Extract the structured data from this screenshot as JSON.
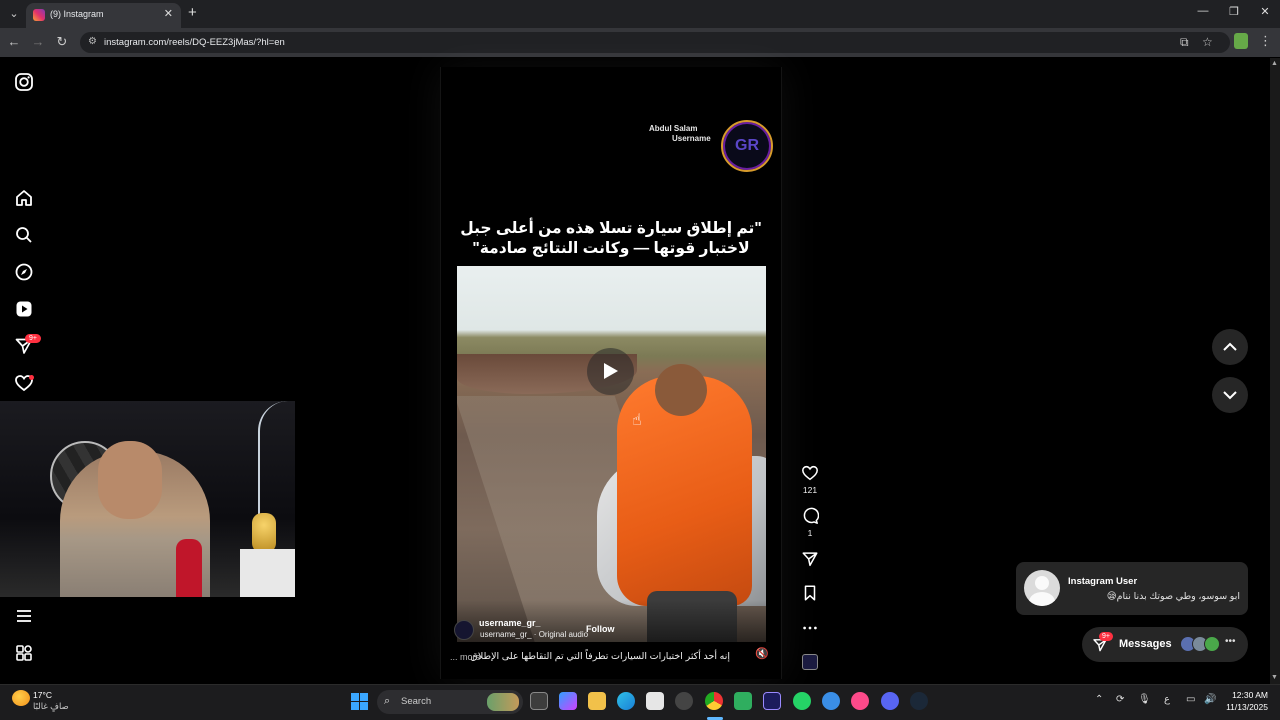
{
  "browser": {
    "tab_title": "(9) Instagram",
    "url": "instagram.com/reels/DQ-EEZ3jMas/?hl=en"
  },
  "sidebar": {
    "messages_badge": "9+"
  },
  "reel": {
    "creator_name": "Abdul Salam",
    "creator_user": "Username",
    "creator_logo_text": "GR",
    "caption": "\"تم إطلاق سيارة تسلا هذه من أعلى جبل لاختبار قوتها — وكانت النتائج صادمة\"",
    "username": "username_gr_",
    "audio": "username_gr_ · Original audio",
    "follow_label": "Follow",
    "description": "إنه أحد أكثر اختبارات السيارات تطرفاً التي تم التقاطها على الإطلاق",
    "more_label": "... more",
    "likes": "121",
    "comments": "1"
  },
  "toast": {
    "title": "Instagram User",
    "message": "ابو سوسو، وطي صوتك بدنا ننام😪"
  },
  "messages": {
    "label": "Messages",
    "badge": "9+"
  },
  "taskbar": {
    "temperature": "17°C",
    "weather": "صافٍ غالبًا",
    "search_label": "Search",
    "lang": "ع",
    "time": "12:30 AM",
    "date": "11/13/2025"
  },
  "colors": {
    "accent_red": "#ff3040",
    "orange": "#e85d16",
    "bg": "#000000"
  }
}
